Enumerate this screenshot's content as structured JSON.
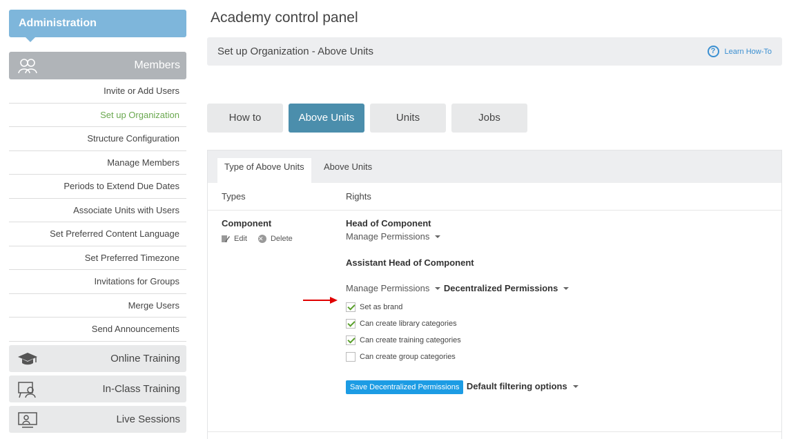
{
  "sidebar": {
    "admin_title": "Administration",
    "members_label": "Members",
    "menu_items": [
      "Invite or Add Users",
      "Set up Organization",
      "Structure Configuration",
      "Manage Members",
      "Periods to Extend Due Dates",
      "Associate Units with Users",
      "Set Preferred Content Language",
      "Set Preferred Timezone",
      "Invitations for Groups",
      "Merge Users",
      "Send Announcements"
    ],
    "sections": [
      {
        "label": "Online Training",
        "icon": "graduation-cap-icon"
      },
      {
        "label": "In-Class Training",
        "icon": "classroom-icon"
      },
      {
        "label": "Live Sessions",
        "icon": "live-session-icon"
      }
    ]
  },
  "page": {
    "title": "Academy control panel",
    "subheader": "Set up Organization - Above Units",
    "learn_howto": "Learn How-To"
  },
  "tabs": [
    "How to",
    "Above Units",
    "Units",
    "Jobs"
  ],
  "subtabs": [
    "Type of Above Units",
    "Above Units"
  ],
  "columns": {
    "types": "Types",
    "rights": "Rights"
  },
  "type": {
    "name": "Component",
    "edit_label": "Edit",
    "delete_label": "Delete"
  },
  "rights": {
    "head_title": "Head of Component",
    "head_dropdown": "Manage Permissions",
    "assistant_title": "Assistant Head of Component",
    "assistant_dropdown": "Manage Permissions",
    "decentralized_title": "Decentralized Permissions",
    "checkboxes": [
      {
        "label": "Set as brand",
        "checked": true
      },
      {
        "label": "Can create library categories",
        "checked": true
      },
      {
        "label": "Can create training categories",
        "checked": true
      },
      {
        "label": "Can create group categories",
        "checked": false
      }
    ],
    "save_button": "Save Decentralized Permissions",
    "default_filtering": "Default filtering options"
  },
  "colors": {
    "accent": "#4b8eac",
    "admin": "#7eb6db",
    "save": "#1c9ce4",
    "active_link": "#6aa84f",
    "arrow": "#e00000"
  }
}
